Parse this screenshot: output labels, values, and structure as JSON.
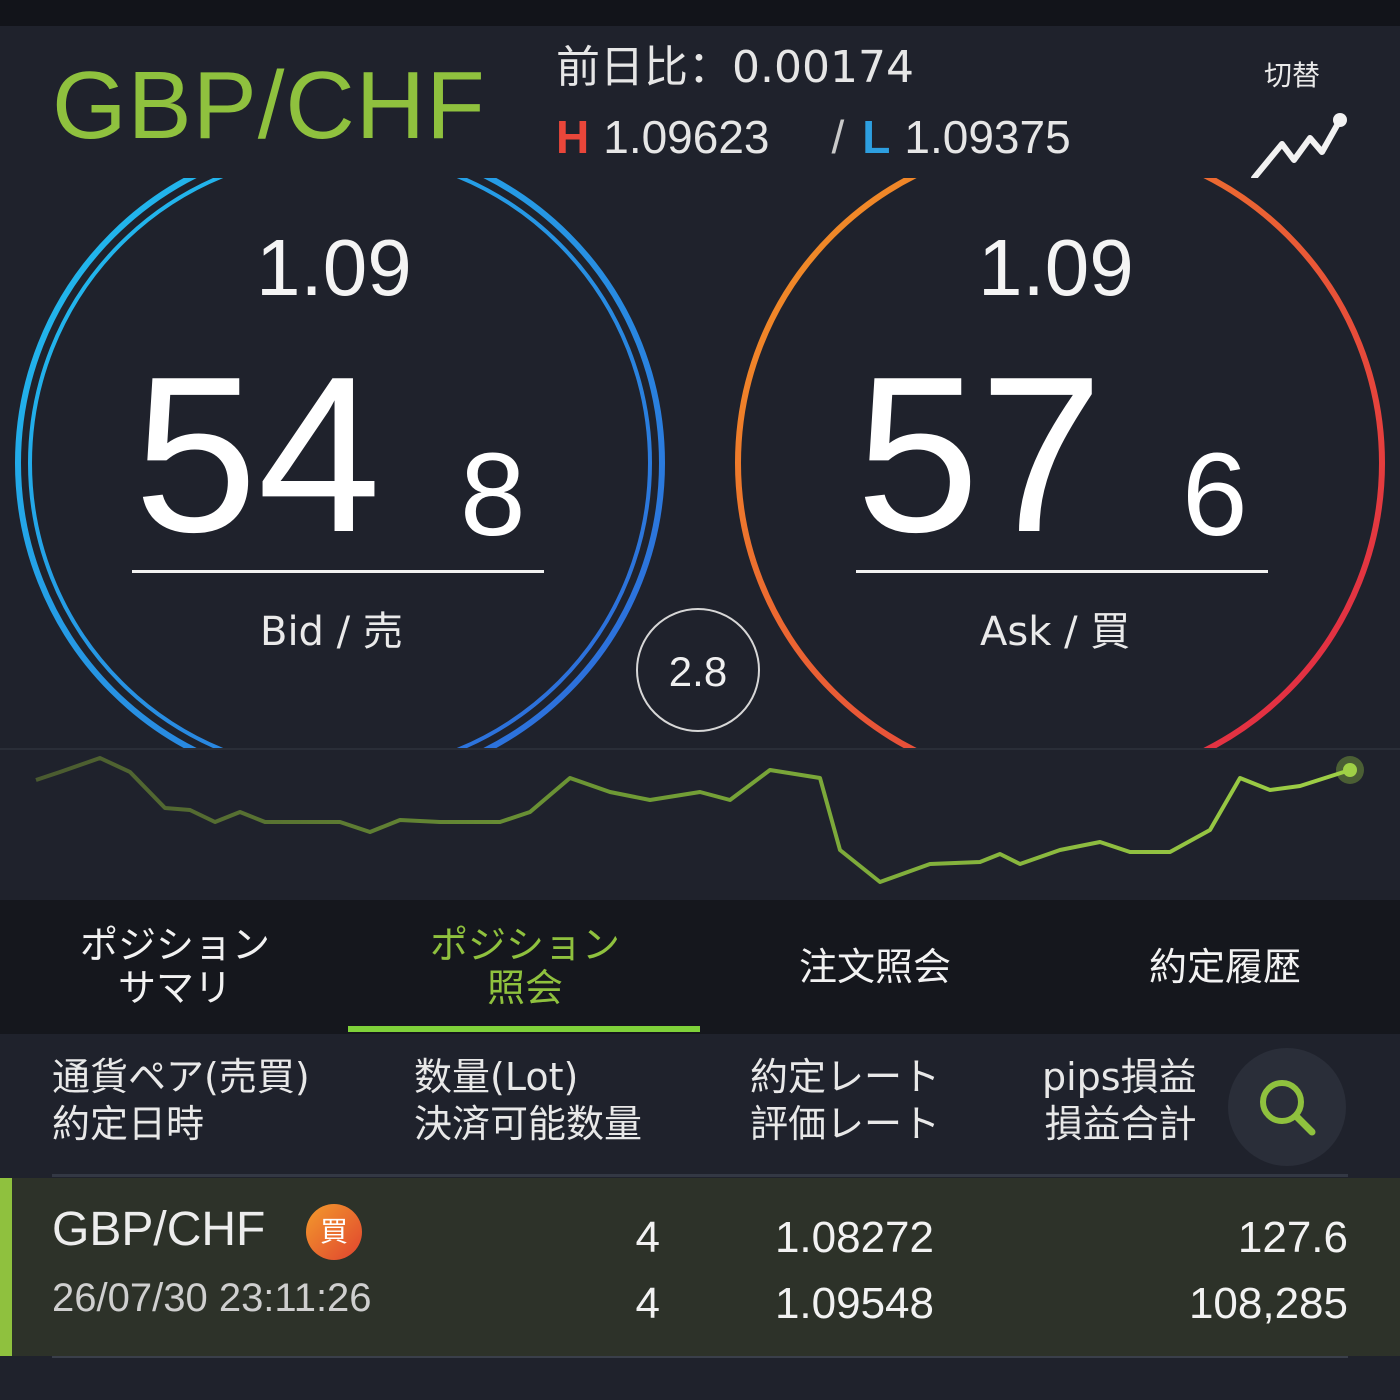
{
  "header": {
    "pair": "GBP/CHF",
    "change_label": "前日比：",
    "change_value": "0.00174",
    "high_label": "H",
    "high_value": "1.09623",
    "separator": "/",
    "low_label": "L",
    "low_value": "1.09375",
    "switch_label": "切替",
    "switch_icon": "chart-line-icon"
  },
  "bid": {
    "prefix": "1.09",
    "big": "54",
    "small": "8",
    "label": "Bid / 売",
    "ring_colors": [
      "#1fc3ef",
      "#2f63d8"
    ]
  },
  "ask": {
    "prefix": "1.09",
    "big": "57",
    "small": "6",
    "label": "Ask / 買",
    "ring_colors": [
      "#f39a22",
      "#e01f48"
    ]
  },
  "spread": "2.8",
  "colors": {
    "accent_green": "#8fc13e",
    "high_red": "#e9463a",
    "low_blue": "#2d9fe0",
    "background": "#1f222c"
  },
  "tabs": [
    {
      "label_line1": "ポジション",
      "label_line2": "サマリ",
      "active": false
    },
    {
      "label_line1": "ポジション",
      "label_line2": "照会",
      "active": true
    },
    {
      "label_line1": "注文照会",
      "label_line2": "",
      "active": false
    },
    {
      "label_line1": "約定履歴",
      "label_line2": "",
      "active": false
    }
  ],
  "table": {
    "headers": [
      {
        "line1": "通貨ペア(売買)",
        "line2": "約定日時"
      },
      {
        "line1": "数量(Lot)",
        "line2": "決済可能数量"
      },
      {
        "line1": "約定レート",
        "line2": "評価レート"
      },
      {
        "line1": "pips損益",
        "line2": "損益合計"
      }
    ],
    "search_icon": "search-icon",
    "rows": [
      {
        "pair": "GBP/CHF",
        "side": "買",
        "datetime": "26/07/30 23:11:26",
        "quantity": "4",
        "settleable": "4",
        "exec_rate": "1.08272",
        "eval_rate": "1.09548",
        "pips": "127.6",
        "total": "108,285"
      }
    ]
  }
}
